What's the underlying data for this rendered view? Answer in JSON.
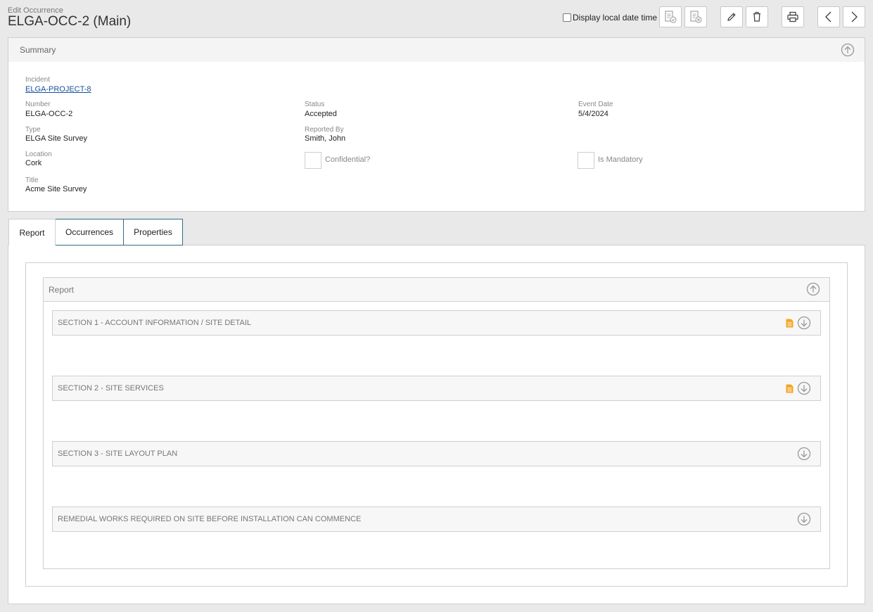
{
  "header": {
    "subtitle": "Edit Occurrence",
    "title": "ELGA-OCC-2 (Main)",
    "local_dt_label": "Display local date time"
  },
  "summary": {
    "heading": "Summary",
    "fields": {
      "incident_label": "Incident",
      "incident_value": "ELGA-PROJECT-8",
      "number_label": "Number",
      "number_value": "ELGA-OCC-2",
      "type_label": "Type",
      "type_value": "ELGA Site Survey",
      "location_label": "Location",
      "location_value": "Cork",
      "title_label": "Title",
      "title_value": "Acme Site Survey",
      "status_label": "Status",
      "status_value": "Accepted",
      "reported_by_label": "Reported By",
      "reported_by_value": "Smith, John",
      "confidential_label": "Confidential?",
      "event_date_label": "Event Date",
      "event_date_value": "5/4/2024",
      "mandatory_label": "Is Mandatory"
    }
  },
  "tabs": [
    {
      "label": "Report"
    },
    {
      "label": "Occurrences"
    },
    {
      "label": "Properties"
    }
  ],
  "report": {
    "heading": "Report",
    "sections": [
      {
        "label": "SECTION 1 - ACCOUNT INFORMATION / SITE DETAIL"
      },
      {
        "label": "SECTION 2 - SITE SERVICES"
      },
      {
        "label": "SECTION 3 - SITE LAYOUT PLAN"
      },
      {
        "label": "REMEDIAL WORKS REQUIRED ON SITE BEFORE INSTALLATION CAN COMMENCE"
      }
    ]
  },
  "colors": {
    "accent_tab_border": "#2d6e7e",
    "link": "#1a4f9c",
    "doc_icon": "#f5a623"
  }
}
